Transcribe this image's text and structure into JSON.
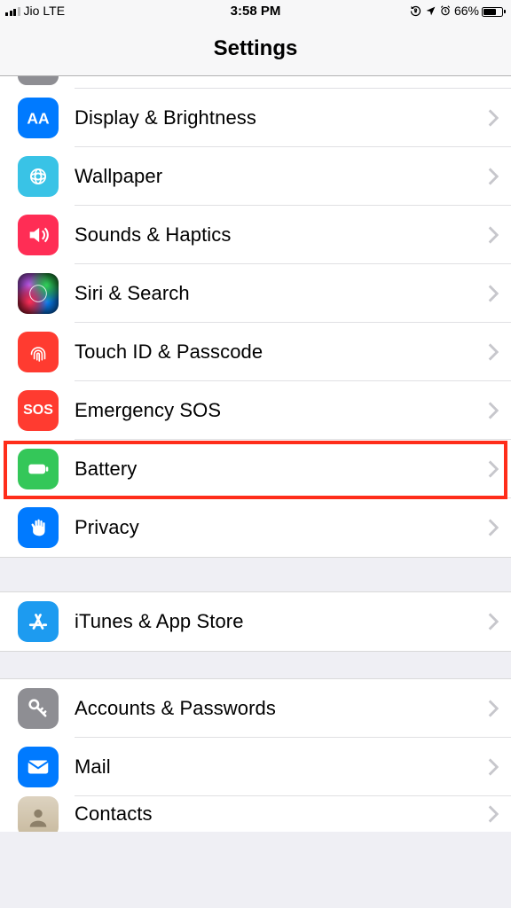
{
  "status": {
    "carrier": "Jio",
    "network": "LTE",
    "time": "3:58 PM",
    "battery_pct": "66%"
  },
  "nav": {
    "title": "Settings"
  },
  "groups": [
    {
      "id": "g1",
      "items": [
        {
          "key": "display",
          "label": "Display & Brightness",
          "icon": "display-icon",
          "color": "bg-blue"
        },
        {
          "key": "wallpaper",
          "label": "Wallpaper",
          "icon": "wallpaper-icon",
          "color": "bg-cyan"
        },
        {
          "key": "sounds",
          "label": "Sounds & Haptics",
          "icon": "sounds-icon",
          "color": "bg-redpink"
        },
        {
          "key": "siri",
          "label": "Siri & Search",
          "icon": "siri-icon",
          "color": "siri-bg"
        },
        {
          "key": "touchid",
          "label": "Touch ID & Passcode",
          "icon": "touchid-icon",
          "color": "bg-red"
        },
        {
          "key": "sos",
          "label": "Emergency SOS",
          "icon": "sos-icon",
          "color": "bg-red"
        },
        {
          "key": "battery",
          "label": "Battery",
          "icon": "battery-icon",
          "color": "bg-green",
          "highlight": true
        },
        {
          "key": "privacy",
          "label": "Privacy",
          "icon": "privacy-icon",
          "color": "bg-blue"
        }
      ]
    },
    {
      "id": "g2",
      "items": [
        {
          "key": "itunes",
          "label": "iTunes & App Store",
          "icon": "appstore-icon",
          "color": "bg-blue2"
        }
      ]
    },
    {
      "id": "g3",
      "items": [
        {
          "key": "accounts",
          "label": "Accounts & Passwords",
          "icon": "key-icon",
          "color": "bg-gray"
        },
        {
          "key": "mail",
          "label": "Mail",
          "icon": "mail-icon",
          "color": "bg-blue"
        },
        {
          "key": "contacts",
          "label": "Contacts",
          "icon": "contacts-icon",
          "color": "contacts-bg",
          "cut": true
        }
      ]
    }
  ],
  "sos_text": "SOS"
}
